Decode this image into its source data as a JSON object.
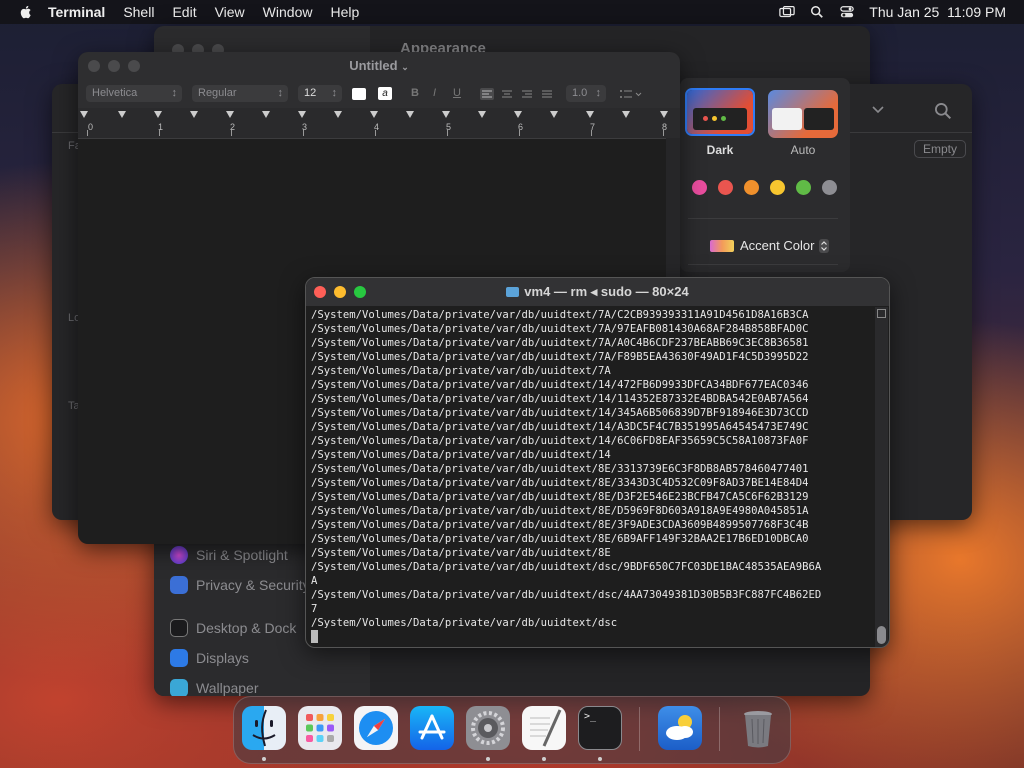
{
  "menubar": {
    "app": "Terminal",
    "items": [
      "Shell",
      "Edit",
      "View",
      "Window",
      "Help"
    ],
    "datetime": "Thu Jan 25  11:09 PM"
  },
  "settings": {
    "heading": "Appearance",
    "sidebar": [
      {
        "label": "Siri & Spotlight",
        "icon": "siri-icon"
      },
      {
        "label": "Privacy & Security",
        "icon": "hand-icon"
      },
      {
        "label": "Desktop & Dock",
        "icon": "dock-icon"
      },
      {
        "label": "Displays",
        "icon": "sun-icon"
      },
      {
        "label": "Wallpaper",
        "icon": "wallpaper-icon"
      }
    ],
    "appearance": {
      "options": [
        {
          "label": "Dark",
          "selected": true
        },
        {
          "label": "Auto",
          "selected": false
        }
      ],
      "accent_colors": [
        "#e94d9e",
        "#e9554f",
        "#f0902c",
        "#f7c62f",
        "#60bb46",
        "#8e8e93"
      ],
      "accent_label": "Accent Color"
    }
  },
  "finder": {
    "empty_label": "Empty",
    "side_letters": [
      "Fa",
      "Lo",
      "Ta"
    ]
  },
  "textedit": {
    "title": "Untitled",
    "font": "Helvetica",
    "style": "Regular",
    "size": "12",
    "spacing": "1.0",
    "ruler_numbers": [
      "0",
      "1",
      "2",
      "3",
      "4",
      "5",
      "6",
      "7",
      "8"
    ]
  },
  "terminal": {
    "title": "vm4 — rm ◂ sudo — 80×24",
    "lines": [
      "/System/Volumes/Data/private/var/db/uuidtext/7A/C2CB939393311A91D4561D8A16B3CA",
      "/System/Volumes/Data/private/var/db/uuidtext/7A/97EAFB081430A68AF284B858BFAD0C",
      "/System/Volumes/Data/private/var/db/uuidtext/7A/A0C4B6CDF237BEABB69C3EC8B36581",
      "/System/Volumes/Data/private/var/db/uuidtext/7A/F89B5EA43630F49AD1F4C5D3995D22",
      "/System/Volumes/Data/private/var/db/uuidtext/7A",
      "/System/Volumes/Data/private/var/db/uuidtext/14/472FB6D9933DFCA34BDF677EAC0346",
      "/System/Volumes/Data/private/var/db/uuidtext/14/114352E87332E4BDBA542E0AB7A564",
      "/System/Volumes/Data/private/var/db/uuidtext/14/345A6B506839D7BF918946E3D73CCD",
      "/System/Volumes/Data/private/var/db/uuidtext/14/A3DC5F4C7B351995A64545473E749C",
      "/System/Volumes/Data/private/var/db/uuidtext/14/6C06FD8EAF35659C5C58A10873FA0F",
      "/System/Volumes/Data/private/var/db/uuidtext/14",
      "/System/Volumes/Data/private/var/db/uuidtext/8E/3313739E6C3F8DB8AB578460477401",
      "/System/Volumes/Data/private/var/db/uuidtext/8E/3343D3C4D532C09F8AD37BE14E84D4",
      "/System/Volumes/Data/private/var/db/uuidtext/8E/D3F2E546E23BCFB47CA5C6F62B3129",
      "/System/Volumes/Data/private/var/db/uuidtext/8E/D5969F8D603A918A9E4980A045851A",
      "/System/Volumes/Data/private/var/db/uuidtext/8E/3F9ADE3CDA3609B4899507768F3C4B",
      "/System/Volumes/Data/private/var/db/uuidtext/8E/6B9AFF149F32BAA2E17B6ED10DBCA0",
      "/System/Volumes/Data/private/var/db/uuidtext/8E",
      "/System/Volumes/Data/private/var/db/uuidtext/dsc/9BDF650C7FC03DE1BAC48535AEA9B6A",
      "A",
      "/System/Volumes/Data/private/var/db/uuidtext/dsc/4AA73049381D30B5B3FC887FC4B62ED",
      "7",
      "/System/Volumes/Data/private/var/db/uuidtext/dsc"
    ]
  },
  "dock": {
    "apps": [
      {
        "name": "Finder",
        "icon": "finder-icon",
        "running": true
      },
      {
        "name": "Launchpad",
        "icon": "launchpad-icon",
        "running": false
      },
      {
        "name": "Safari",
        "icon": "safari-icon",
        "running": false
      },
      {
        "name": "App Store",
        "icon": "app-store-icon",
        "running": false
      },
      {
        "name": "System Settings",
        "icon": "system-settings-icon",
        "running": true
      },
      {
        "name": "TextEdit",
        "icon": "textedit-icon",
        "running": true
      },
      {
        "name": "Terminal",
        "icon": "terminal-icon",
        "running": true
      },
      {
        "name": "Weather",
        "icon": "weather-icon",
        "running": false
      },
      {
        "name": "Trash",
        "icon": "trash-icon",
        "running": false
      }
    ]
  }
}
